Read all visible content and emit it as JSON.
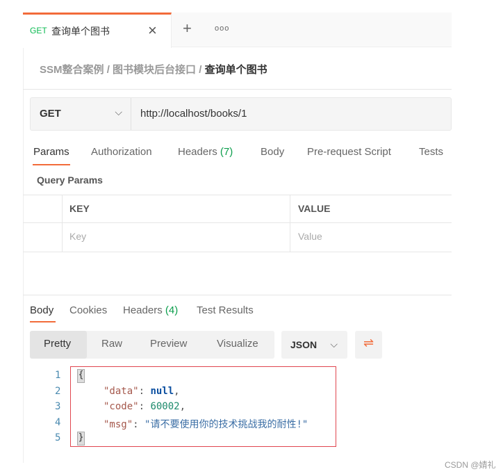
{
  "tab": {
    "method": "GET",
    "title": "查询单个图书",
    "close": "×",
    "new": "+",
    "more": "ooo"
  },
  "breadcrumb": [
    "SSM整合案例",
    "图书模块后台接口",
    "查询单个图书"
  ],
  "breadcrumb_sep": "/",
  "request": {
    "method": "GET",
    "url": "http://localhost/books/1"
  },
  "request_tabs": {
    "params": "Params",
    "authorization": "Authorization",
    "headers": "Headers",
    "headers_count": "(7)",
    "body": "Body",
    "prerequest": "Pre-request Script",
    "tests": "Tests"
  },
  "query_params": {
    "title": "Query Params",
    "key_header": "KEY",
    "value_header": "VALUE",
    "key_placeholder": "Key",
    "value_placeholder": "Value"
  },
  "response_tabs": {
    "body": "Body",
    "cookies": "Cookies",
    "headers": "Headers",
    "headers_count": "(4)",
    "test_results": "Test Results"
  },
  "view_modes": [
    "Pretty",
    "Raw",
    "Preview",
    "Visualize"
  ],
  "format": "JSON",
  "code": {
    "lines": [
      "1",
      "2",
      "3",
      "4",
      "5"
    ],
    "open": "{",
    "close": "}",
    "data_key": "\"data\"",
    "data_val": "null",
    "code_key": "\"code\"",
    "code_val": "60002",
    "msg_key": "\"msg\"",
    "msg_val": "\"请不要使用你的技术挑战我的耐性!\""
  },
  "watermark": "CSDN @婧礼",
  "colors": {
    "accent": "#f26b3a",
    "get": "#0cbb52",
    "highlight_box": "#e0454f"
  }
}
